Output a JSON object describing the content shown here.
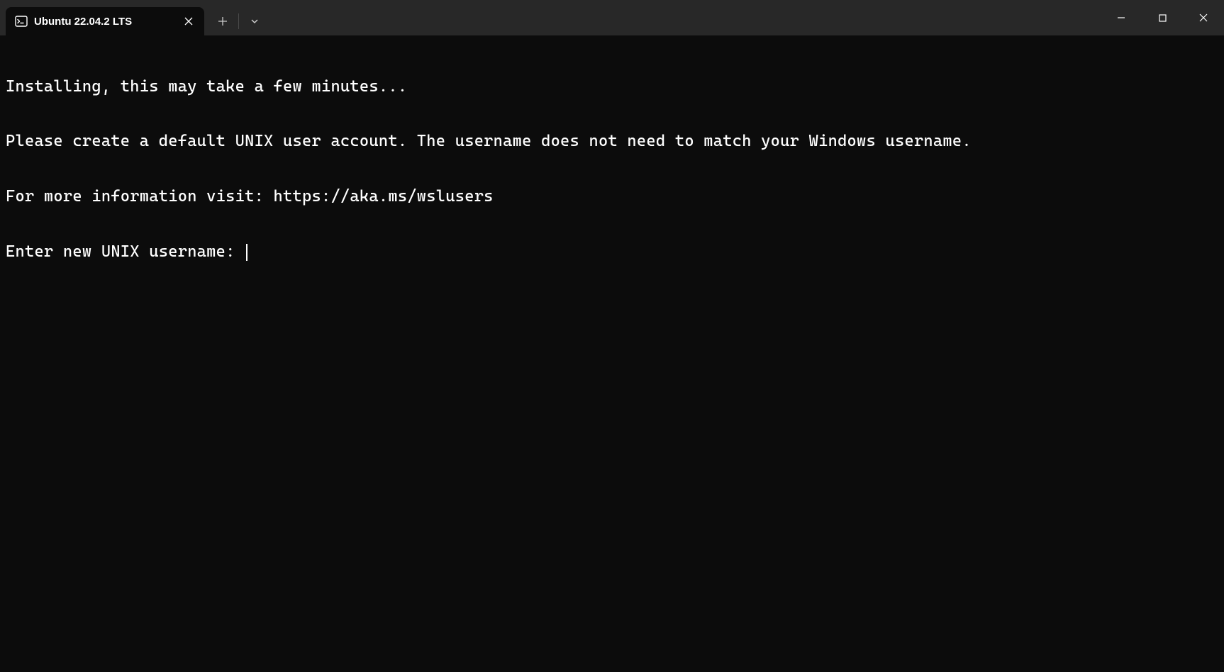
{
  "titlebar": {
    "tab": {
      "title": "Ubuntu 22.04.2 LTS",
      "icon": "terminal-icon"
    }
  },
  "terminal": {
    "lines": [
      "Installing, this may take a few minutes...",
      "Please create a default UNIX user account. The username does not need to match your Windows username.",
      "For more information visit: https://aka.ms/wslusers"
    ],
    "prompt": "Enter new UNIX username: "
  }
}
